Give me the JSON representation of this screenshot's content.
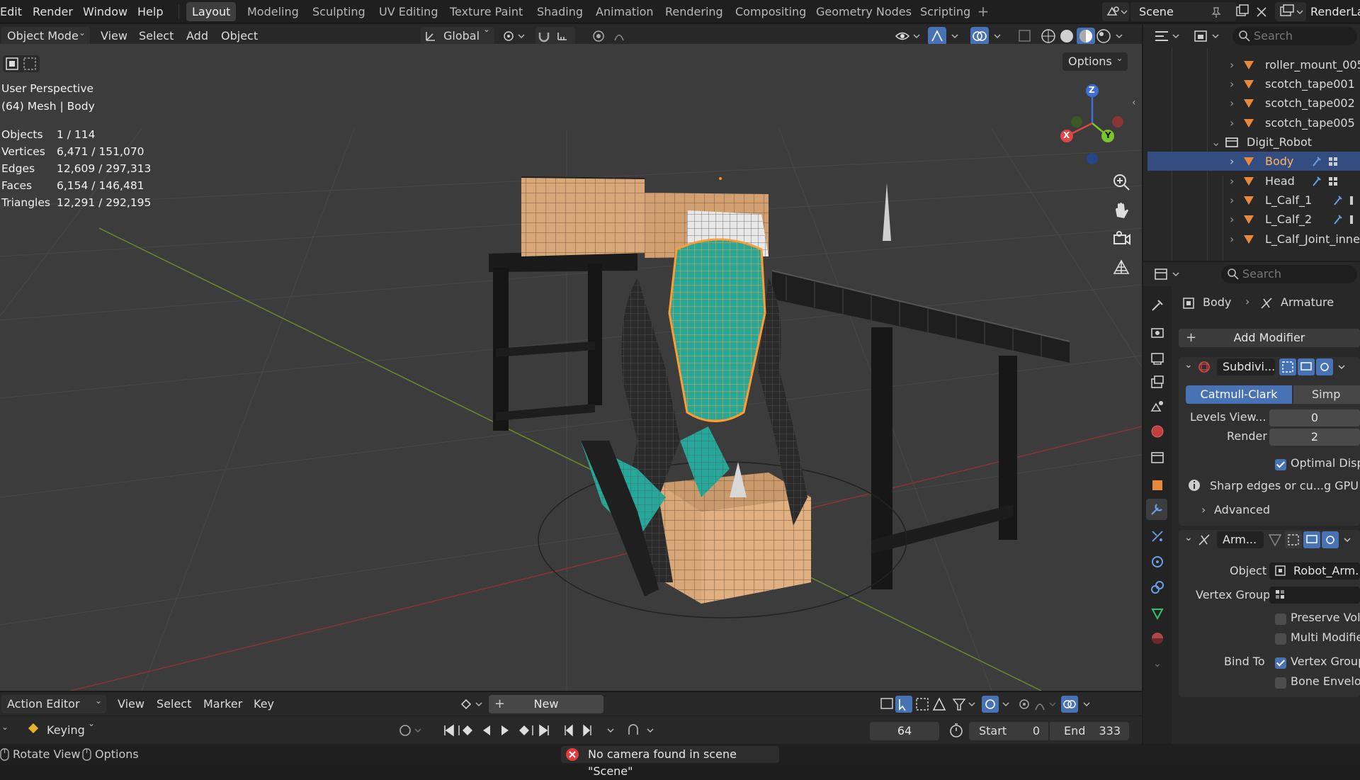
{
  "menu": {
    "items": [
      "Edit",
      "Render",
      "Window",
      "Help"
    ]
  },
  "workspaces": [
    "Layout",
    "Modeling",
    "Sculpting",
    "UV Editing",
    "Texture Paint",
    "Shading",
    "Animation",
    "Rendering",
    "Compositing",
    "Geometry Nodes",
    "Scripting"
  ],
  "active_workspace": "Layout",
  "scene": {
    "name": "Scene",
    "view_layer": "RenderLa"
  },
  "viewport": {
    "mode": "Object Mode",
    "menus": [
      "View",
      "Select",
      "Add",
      "Object"
    ],
    "orientation": "Global",
    "options_label": "Options",
    "perspective": "User Perspective",
    "selection_info": "(64) Mesh | Body",
    "stats": [
      {
        "label": "Objects",
        "value": "1 / 114"
      },
      {
        "label": "Vertices",
        "value": "6,471 / 151,070"
      },
      {
        "label": "Edges",
        "value": "12,609 / 297,313"
      },
      {
        "label": "Faces",
        "value": "6,154 / 146,481"
      },
      {
        "label": "Triangles",
        "value": "12,291 / 292,195"
      }
    ],
    "gizmo": {
      "x": "X",
      "y": "Y",
      "z": "Z"
    }
  },
  "outliner": {
    "search_placeholder": "Search",
    "items": [
      {
        "name": "roller_mount_005",
        "type": "mesh"
      },
      {
        "name": "scotch_tape001",
        "type": "mesh"
      },
      {
        "name": "scotch_tape002",
        "type": "mesh"
      },
      {
        "name": "scotch_tape005",
        "type": "mesh"
      },
      {
        "name": "Digit_Robot",
        "type": "collection"
      },
      {
        "name": "Body",
        "type": "mesh",
        "selected": true
      },
      {
        "name": "Head",
        "type": "mesh"
      },
      {
        "name": "L_Calf_1",
        "type": "mesh"
      },
      {
        "name": "L_Calf_2",
        "type": "mesh"
      },
      {
        "name": "L_Calf_Joint_inner",
        "type": "mesh"
      }
    ]
  },
  "properties": {
    "search_placeholder": "Search",
    "breadcrumb_object": "Body",
    "breadcrumb_modifier": "Armature",
    "add_modifier": "Add Modifier",
    "subdiv": {
      "name": "Subdivi...",
      "catmull": "Catmull-Clark",
      "simple": "Simp",
      "levels_label": "Levels View...",
      "levels_value": "0",
      "render_label": "Render",
      "render_value": "2",
      "optimal_label": "Optimal Displa",
      "info": "Sharp edges or cu...g GPU su",
      "advanced": "Advanced"
    },
    "armature": {
      "name": "Arm...",
      "object_label": "Object",
      "object_value": "Robot_Arm...",
      "vgroup_label": "Vertex Group",
      "preserve": "Preserve Volu",
      "multi": "Multi Modifier",
      "bind_label": "Bind To",
      "vertex_groups": "Vertex Groups",
      "bone_env": "Bone Envelop"
    }
  },
  "action_editor": {
    "mode": "Action Editor",
    "menus": [
      "View",
      "Select",
      "Marker",
      "Key"
    ],
    "new_label": "New"
  },
  "timeline": {
    "keying": "Keying",
    "current_frame": "64",
    "start_label": "Start",
    "start": "0",
    "end_label": "End",
    "end": "333"
  },
  "statusbar": {
    "rotate": "Rotate View",
    "options": "Options",
    "error": "No camera found in scene \"Scene\""
  },
  "colors": {
    "accent": "#4772b3",
    "selected_orange": "#e8883a",
    "teal": "#25a89a",
    "box": "#d9a878",
    "error": "#e23c3c"
  }
}
